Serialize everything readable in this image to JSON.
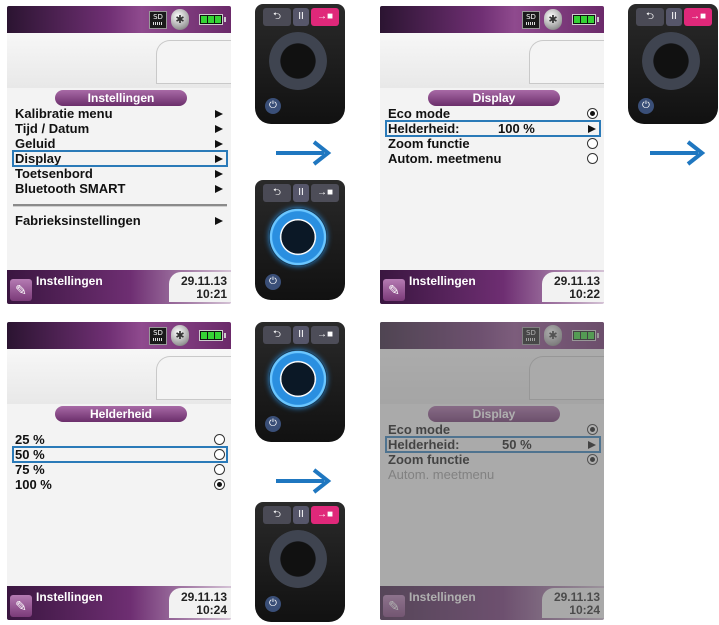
{
  "status_icons": {
    "sd_label": "SD",
    "bluetooth_glyph": "✱"
  },
  "remote_glyphs": {
    "back": "⮌",
    "pause": "II",
    "enter": "→■",
    "power": "⏻"
  },
  "arrow_color": "#1f77c0",
  "accent_color": "#7a3a78",
  "panels": {
    "p1": {
      "title": "Instellingen",
      "items": [
        "Kalibratie menu",
        "Tijd / Datum",
        "Geluid",
        "Display",
        "Toetsenbord",
        "Bluetooth SMART"
      ],
      "extra_item": "Fabrieksinstellingen",
      "selected": "Display",
      "status_label": "Instellingen",
      "date": "29.11.13",
      "time": "10:21"
    },
    "p2": {
      "title": "Display",
      "items": [
        "Eco mode",
        "Helderheid:",
        "Zoom functie",
        "Autom. meetmenu"
      ],
      "brightness_value": "100 %",
      "selected": "Helderheid:",
      "status_label": "Instellingen",
      "date": "29.11.13",
      "time": "10:22"
    },
    "p3": {
      "title": "Helderheid",
      "options": [
        "25 %",
        "50 %",
        "75 %",
        "100 %"
      ],
      "selected": "50 %",
      "checked": "100 %",
      "status_label": "Instellingen",
      "date": "29.11.13",
      "time": "10:24"
    },
    "p4": {
      "title": "Display",
      "items": [
        "Eco mode",
        "Helderheid:",
        "Zoom functie",
        "Autom. meetmenu"
      ],
      "brightness_value": "50 %",
      "selected": "Helderheid:",
      "disabled_item": "Autom. meetmenu",
      "status_label": "Instellingen",
      "date": "29.11.13",
      "time": "10:24"
    }
  }
}
